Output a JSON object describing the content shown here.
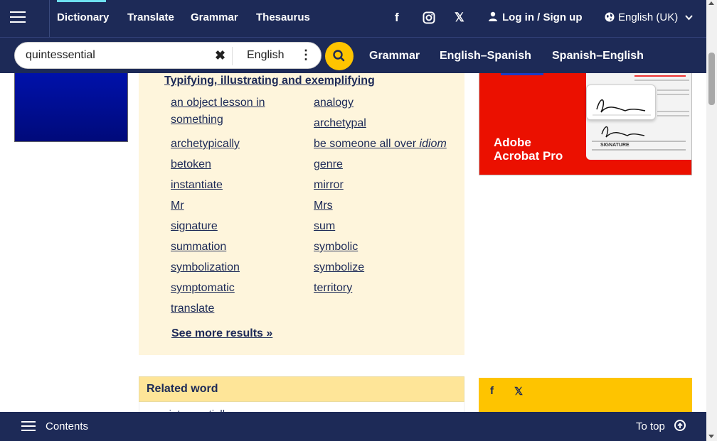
{
  "nav": {
    "links": [
      "Dictionary",
      "Translate",
      "Grammar",
      "Thesaurus"
    ],
    "social": [
      "facebook-icon",
      "instagram-icon",
      "x-icon"
    ],
    "login": "Log in / Sign up",
    "language": "English (UK)"
  },
  "search": {
    "value": "quintessential",
    "language": "English",
    "links": [
      "Grammar",
      "English–Spanish",
      "Spanish–English"
    ]
  },
  "panel": {
    "heading": "Typifying, illustrating and exemplifying",
    "left_words": [
      "an object lesson in something",
      "archetypically",
      "betoken",
      "instantiate",
      "Mr",
      "signature",
      "summation",
      "symbolization",
      "symptomatic",
      "translate"
    ],
    "right_words": [
      "analogy",
      "archetypal",
      "be someone all over",
      "genre",
      "mirror",
      "Mrs",
      "sum",
      "symbolic",
      "symbolize",
      "territory"
    ],
    "right_suffix": "idiom",
    "see_more": "See more results »"
  },
  "related": {
    "title": "Related word",
    "partial": "quintessentially"
  },
  "ad": {
    "brand_line1": "Adobe",
    "brand_line2": "Acrobat Pro",
    "sig_label": "SIGNATURE"
  },
  "bottom": {
    "contents": "Contents",
    "to_top": "To top"
  },
  "colors": {
    "navy": "#1d2a57",
    "yellow": "#fec400",
    "panel_bg": "#fef5dc",
    "related_bg": "#fee598",
    "adobe_red": "#eb1000"
  }
}
